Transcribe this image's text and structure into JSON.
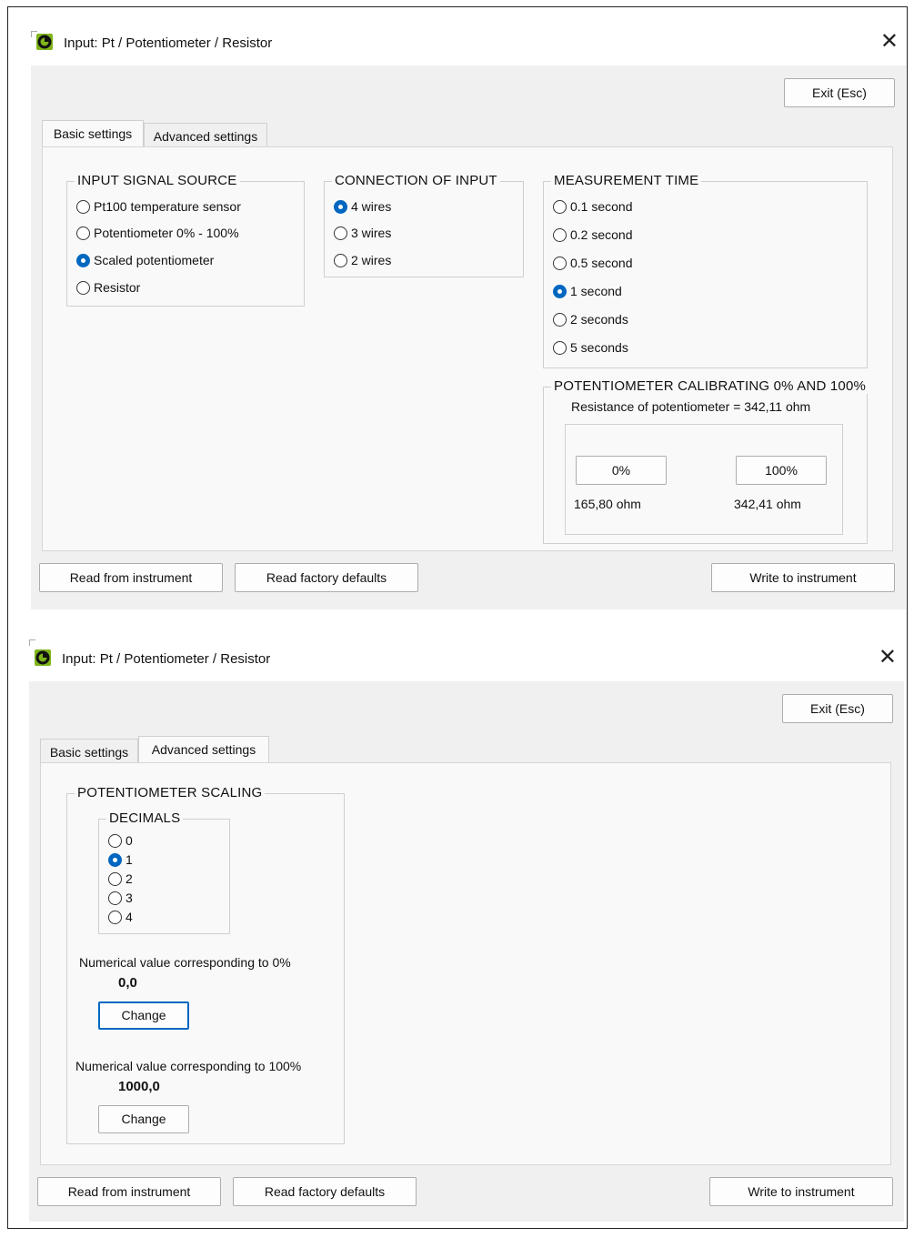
{
  "window_title": "Input: Pt / Potentiometer / Resistor",
  "exit_button": "Exit (Esc)",
  "tabs": [
    "Basic settings",
    "Advanced settings"
  ],
  "footer": {
    "read_instrument": "Read from instrument",
    "read_defaults": "Read factory defaults",
    "write_instrument": "Write to instrument"
  },
  "basic": {
    "input_source": {
      "title": "INPUT SIGNAL SOURCE",
      "options": [
        "Pt100 temperature sensor",
        "Potentiometer 0% - 100%",
        "Scaled potentiometer",
        "Resistor"
      ],
      "selected": "Scaled potentiometer"
    },
    "connection": {
      "title": "CONNECTION OF INPUT",
      "options": [
        "4 wires",
        "3 wires",
        "2 wires"
      ],
      "selected": "4 wires"
    },
    "measurement_time": {
      "title": "MEASUREMENT TIME",
      "options": [
        "0.1 second",
        "0.2 second",
        "0.5 second",
        "1 second",
        "2 seconds",
        "5 seconds"
      ],
      "selected": "1 second"
    },
    "calibration": {
      "title": "POTENTIOMETER CALIBRATING 0% AND 100%",
      "resistance_text": "Resistance of potentiometer = 342,11 ohm",
      "btn_0": "0%",
      "btn_100": "100%",
      "value_0": "165,80 ohm",
      "value_100": "342,41 ohm"
    }
  },
  "advanced": {
    "scaling_title": "POTENTIOMETER SCALING",
    "decimals": {
      "title": "DECIMALS",
      "options": [
        "0",
        "1",
        "2",
        "3",
        "4"
      ],
      "selected": "1"
    },
    "label_0": "Numerical value corresponding to 0%",
    "value_0": "0,0",
    "label_100": "Numerical value corresponding to 100%",
    "value_100": "1000,0",
    "change": "Change"
  }
}
